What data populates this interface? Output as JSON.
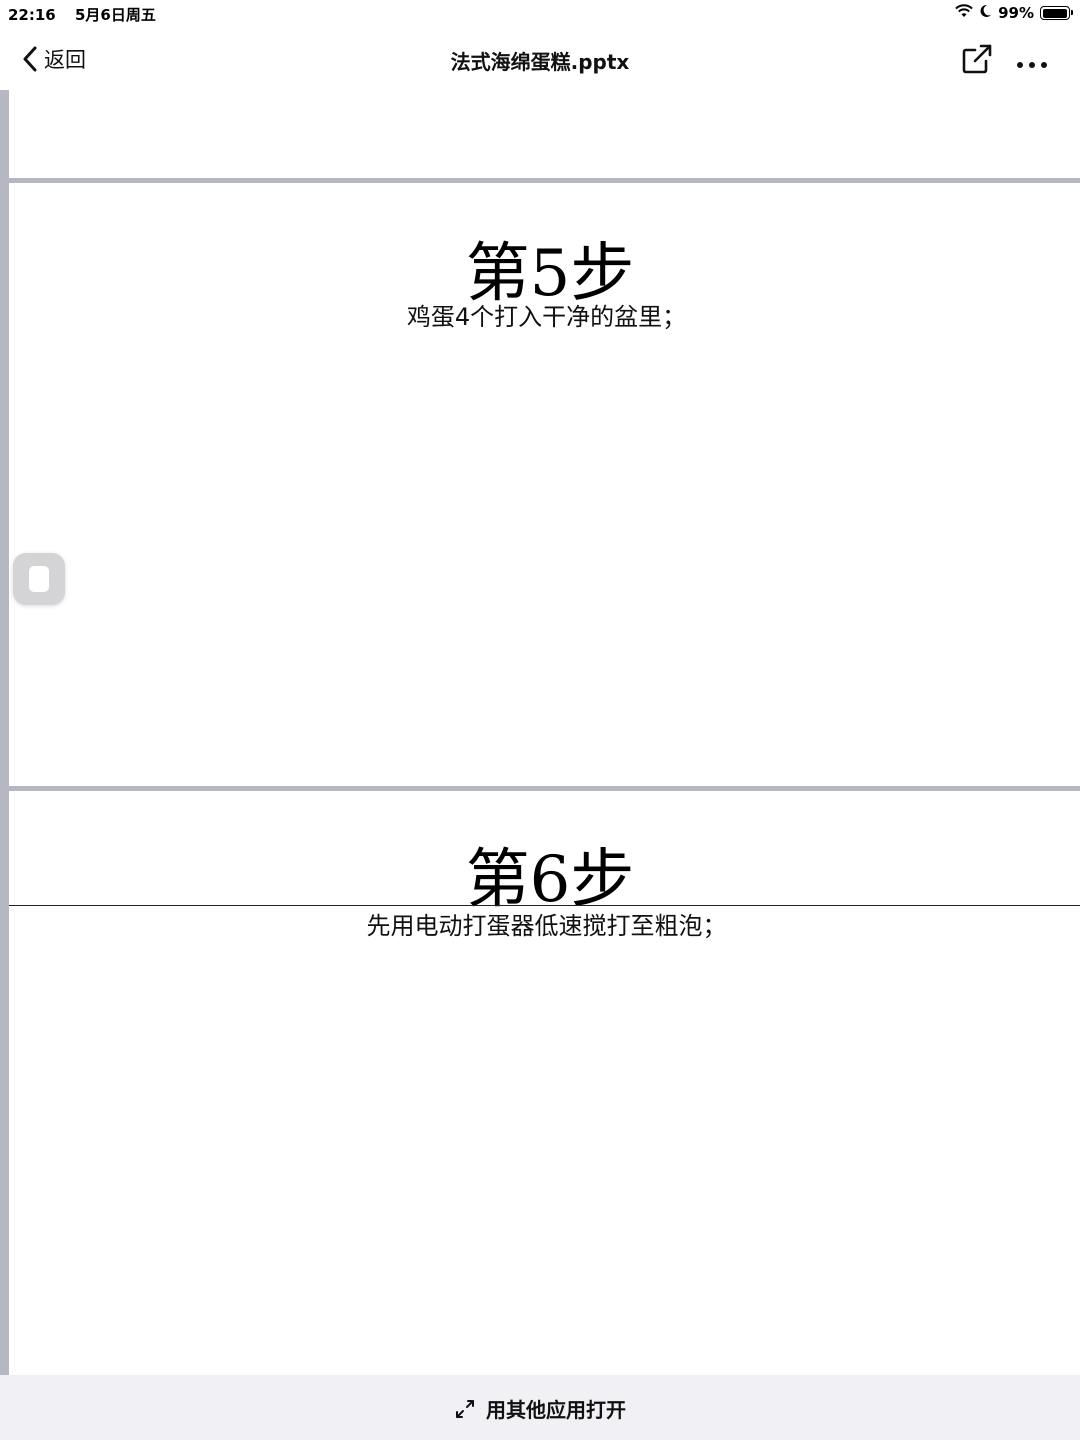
{
  "status_bar": {
    "time": "22:16",
    "date": "5月6日周五",
    "battery_text": "99%",
    "battery_level": 0.99
  },
  "nav": {
    "back_label": "返回",
    "title": "法式海绵蛋糕.pptx"
  },
  "slides": [
    {
      "title": "第5步",
      "text": "鸡蛋4个打入干净的盆里；"
    },
    {
      "title": "第6步",
      "text": "先用电动打蛋器低速搅打至粗泡；"
    }
  ],
  "bottom_bar": {
    "open_with_label": "用其他应用打开"
  },
  "colors": {
    "rail": "#b5b8c2",
    "bottom_bar_bg": "#f1f1f5",
    "handle_bg": "#d4d4d6"
  }
}
